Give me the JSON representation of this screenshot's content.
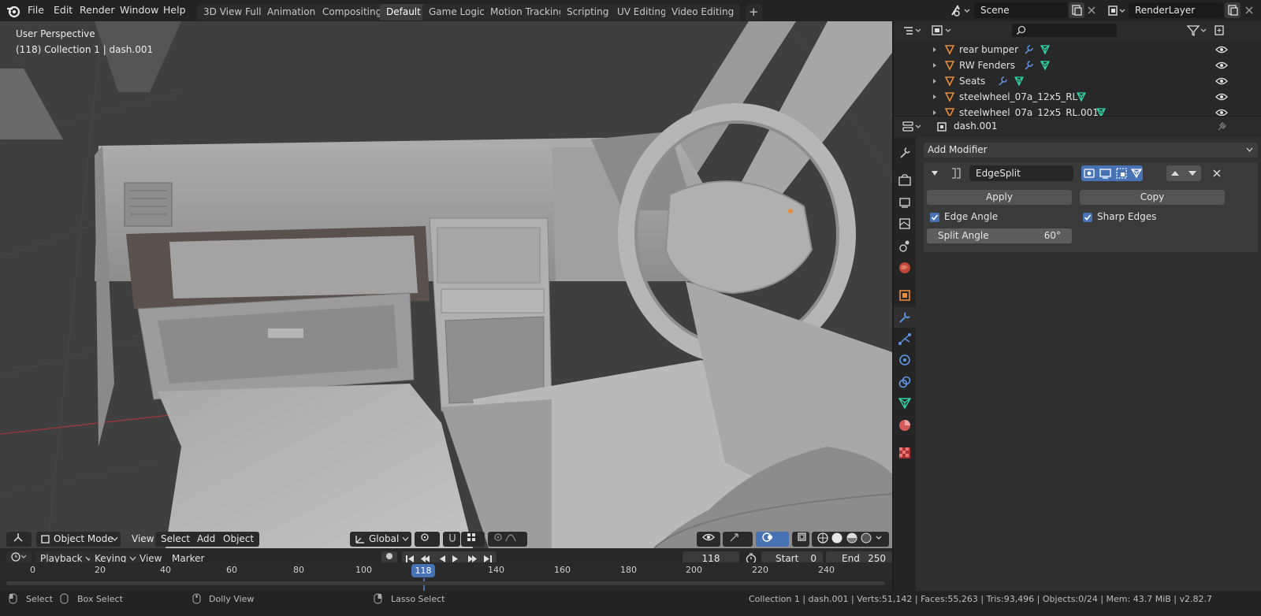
{
  "menu": [
    "File",
    "Edit",
    "Render",
    "Window",
    "Help"
  ],
  "workspaces": [
    {
      "label": "3D View Full",
      "active": false
    },
    {
      "label": "Animation",
      "active": false
    },
    {
      "label": "Compositing",
      "active": false
    },
    {
      "label": "Default",
      "active": true
    },
    {
      "label": "Game Logic",
      "active": false
    },
    {
      "label": "Motion Tracking",
      "active": false
    },
    {
      "label": "Scripting",
      "active": false
    },
    {
      "label": "UV Editing",
      "active": false
    },
    {
      "label": "Video Editing",
      "active": false
    }
  ],
  "add_workspace_symbol": "+",
  "scene": "Scene",
  "render_layer": "RenderLayer",
  "viewport": {
    "perspective": "User Perspective",
    "info": "(118) Collection 1 | dash.001",
    "mode": "Object Mode",
    "menus": [
      "View",
      "Select",
      "Add",
      "Object"
    ],
    "orientation": "Global"
  },
  "timeline": {
    "menus": [
      "Playback",
      "Keying",
      "View",
      "Marker"
    ],
    "current_frame": "118",
    "start_label": "Start",
    "start": "0",
    "end_label": "End",
    "end": "250",
    "ticks": [
      "0",
      "20",
      "40",
      "60",
      "80",
      "100",
      "140",
      "160",
      "180",
      "200",
      "220",
      "240"
    ],
    "playhead": "118"
  },
  "outliner": {
    "items": [
      {
        "label": "rear bumper"
      },
      {
        "label": "RW Fenders"
      },
      {
        "label": "Seats"
      },
      {
        "label": "steelwheel_07a_12x5_RL"
      },
      {
        "label": "steelwheel_07a_12x5_RL.001"
      }
    ]
  },
  "properties": {
    "object_name": "dash.001",
    "add_modifier": "Add Modifier",
    "modifier_name": "EdgeSplit",
    "apply": "Apply",
    "copy": "Copy",
    "edge_angle": "Edge Angle",
    "sharp_edges": "Sharp Edges",
    "split_angle_label": "Split Angle",
    "split_angle_value": "60°"
  },
  "statusbar": {
    "select": "Select",
    "box_select": "Box Select",
    "dolly_view": "Dolly View",
    "lasso_select": "Lasso Select",
    "stats": "Collection 1 | dash.001 | Verts:51,142 | Faces:55,263 | Tris:93,496 | Objects:0/24 | Mem: 43.7 MiB | v2.82.7"
  },
  "colors": {
    "accent": "#4772b3",
    "active_tab": "#3d3d3d",
    "object_icon": "#e98b3a",
    "mesh_icon": "#2fd3a4"
  }
}
